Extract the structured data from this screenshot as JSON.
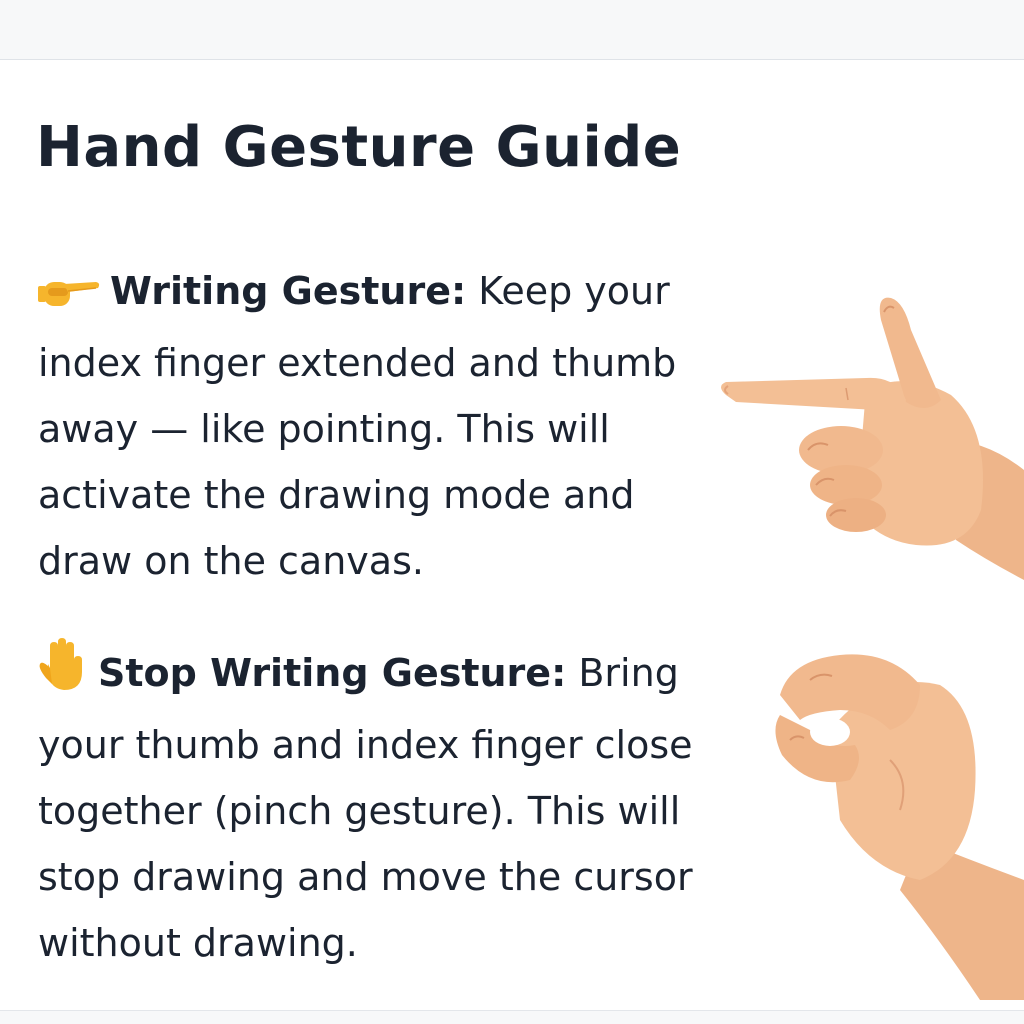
{
  "guide": {
    "title": "Hand Gesture Guide",
    "sections": [
      {
        "icon": "pointing-finger-emoji-icon",
        "heading": "Writing Gesture:",
        "body": "Keep your index finger extended and thumb away — like pointing. This will activate the drawing mode and draw on the canvas.",
        "illustration": "pointing-hand-illustration"
      },
      {
        "icon": "raised-hand-emoji-icon",
        "heading": "Stop Writing Gesture:",
        "body": "Bring your thumb and index finger close together (pinch gesture). This will stop drawing and move the cursor without drawing.",
        "illustration": "pinch-hand-illustration"
      }
    ]
  },
  "colors": {
    "text": "#1b2330",
    "skin": "#f1b98e",
    "emoji_yellow": "#f6b52c",
    "background": "#ffffff"
  }
}
